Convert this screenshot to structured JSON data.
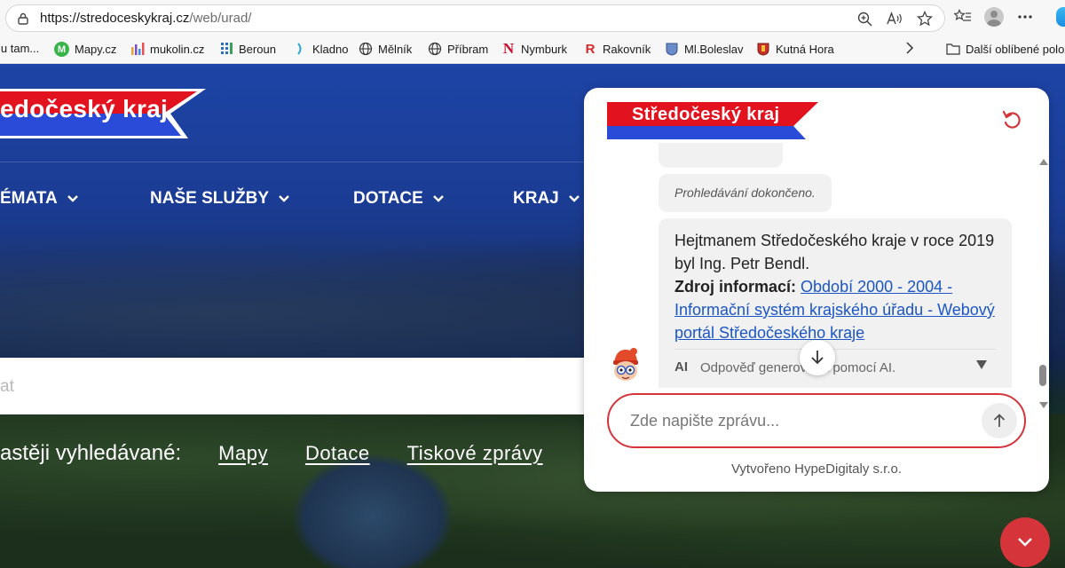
{
  "browser": {
    "url_host": "https://stredoceskykraj.cz",
    "url_path": "/web/urad/",
    "bookmarks": [
      {
        "label": "lu tam...",
        "icon": "generic-favicon"
      },
      {
        "label": "Mapy.cz",
        "icon": "mapy-favicon"
      },
      {
        "label": "mukolin.cz",
        "icon": "mukolin-favicon"
      },
      {
        "label": "Beroun",
        "icon": "beroun-favicon"
      },
      {
        "label": "Kladno",
        "icon": "kladno-favicon"
      },
      {
        "label": "Mělník",
        "icon": "globe-icon"
      },
      {
        "label": "Příbram",
        "icon": "globe-icon"
      },
      {
        "label": "Nymburk",
        "icon": "nymburk-favicon"
      },
      {
        "label": "Rakovník",
        "icon": "rakovnik-favicon"
      },
      {
        "label": "Ml.Boleslav",
        "icon": "boleslav-favicon"
      },
      {
        "label": "Kutná Hora",
        "icon": "kutna-hora-favicon"
      }
    ],
    "other_favorites": "Další oblíbené polož"
  },
  "site": {
    "logo_text": "edočeský kraj",
    "nav": [
      {
        "label": "ÉMATA"
      },
      {
        "label": "NAŠE SLUŽBY"
      },
      {
        "label": "DOTACE"
      },
      {
        "label": "KRAJ"
      }
    ],
    "search_placeholder": "at",
    "frequent_label": "astěji vyhledávané:",
    "frequent_links": [
      "Mapy",
      "Dotace",
      "Tiskové zprávy"
    ]
  },
  "chat": {
    "logo_text": "Středočeský kraj",
    "status_message": "Prohledávání dokončeno.",
    "answer": {
      "text": "Hejtmanem Středočeského kraje v roce 2019 byl Ing. Petr Bendl.",
      "source_label": "Zdroj informací:",
      "source_link": "Období 2000 - 2004 - Informační systém krajského úřadu - Webový portál Středočeského kraje"
    },
    "ai_badge": "AI",
    "ai_note": "Odpověď generována pomocí AI.",
    "input_placeholder": "Zde napište zprávu...",
    "footer": "Vytvořeno HypeDigitaly s.r.o."
  },
  "colors": {
    "brand_red": "#e3121f",
    "brand_blue": "#2a4bd8",
    "site_blue": "#1d44a6",
    "input_border": "#d4343a",
    "link": "#1a56c4"
  }
}
